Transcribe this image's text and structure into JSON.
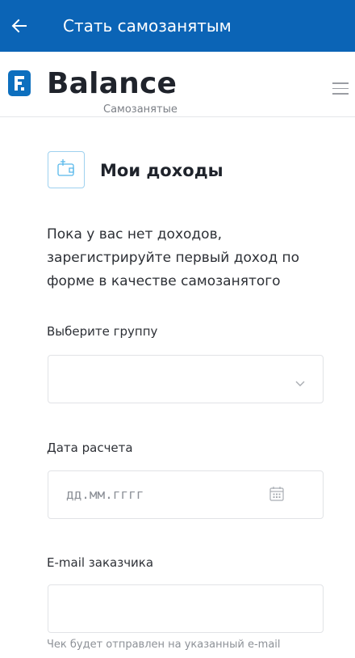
{
  "header": {
    "back_icon": "arrow-left-icon",
    "title": "Стать самозанятым",
    "background_color": "#0b64b6"
  },
  "brand": {
    "logo_icon": "balance-logo-icon",
    "name": "Balance",
    "subtitle": "Самозанятые",
    "menu_icon": "hamburger-menu-icon",
    "logo_color": "#0d6fbe"
  },
  "income_section": {
    "icon": "wallet-icon",
    "title": "Мои доходы",
    "empty_message": "Пока у вас нет доходов, зарегистрируйте первый доход по форме в качестве самозанятого"
  },
  "form": {
    "group": {
      "label": "Выберите группу",
      "value": "",
      "icon": "chevron-down-icon"
    },
    "date": {
      "label": "Дата расчета",
      "placeholder": "дд.мм.гггг",
      "icon": "calendar-icon"
    },
    "email": {
      "label": "E-mail заказчика",
      "value": "",
      "hint": "Чек будет отправлен на указанный e-mail"
    }
  }
}
